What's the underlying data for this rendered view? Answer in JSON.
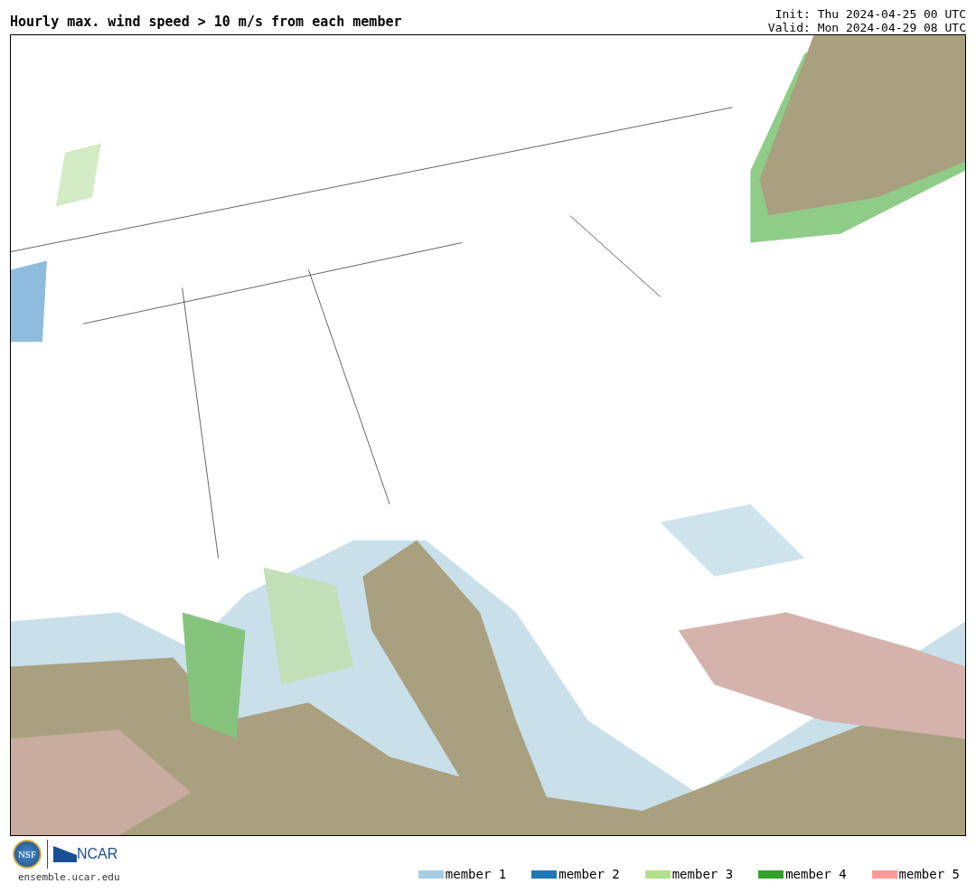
{
  "title": "Hourly max. wind speed > 10 m/s from each member",
  "init": "Init: Thu 2024-04-25 00 UTC",
  "valid": "Valid: Mon 2024-04-29 08 UTC",
  "logos": {
    "nsf": "NSF",
    "ncar": "NCAR",
    "url": "ensemble.ucar.edu"
  },
  "legend": [
    {
      "label": "member 1",
      "color": "#a6cee3"
    },
    {
      "label": "member 2",
      "color": "#1f78b4"
    },
    {
      "label": "member 3",
      "color": "#b2df8a"
    },
    {
      "label": "member 4",
      "color": "#33a02c"
    },
    {
      "label": "member 5",
      "color": "#fb9a99"
    }
  ]
}
